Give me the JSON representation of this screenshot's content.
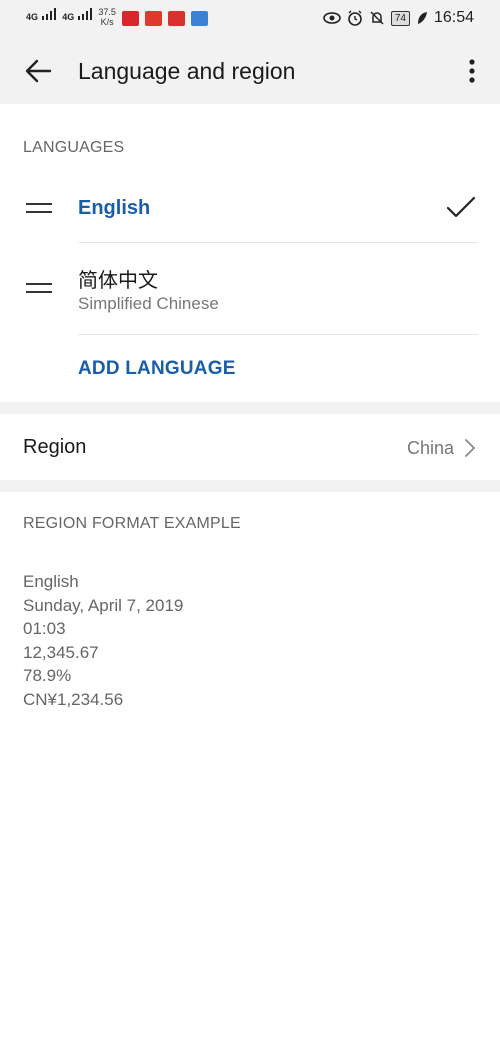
{
  "status_bar": {
    "signal1": "4G",
    "signal2": "4G",
    "net_speed_value": "37.5",
    "net_speed_unit": "K/s",
    "battery": "74",
    "time": "16:54"
  },
  "header": {
    "title": "Language and region"
  },
  "languages": {
    "section_label": "LANGUAGES",
    "items": [
      {
        "name": "English",
        "subtitle": "",
        "selected": true
      },
      {
        "name": "简体中文",
        "subtitle": "Simplified Chinese",
        "selected": false
      }
    ],
    "add_label": "ADD LANGUAGE"
  },
  "region": {
    "label": "Region",
    "value": "China"
  },
  "format_example": {
    "section_label": "REGION FORMAT EXAMPLE",
    "lines": [
      "English",
      "Sunday, April 7, 2019",
      "01:03",
      "12,345.67",
      "78.9%",
      "CN¥1,234.56"
    ]
  },
  "colors": {
    "accent": "#1a5ea8",
    "background_gray": "#f2f2f2",
    "secondary_text": "#666666"
  }
}
